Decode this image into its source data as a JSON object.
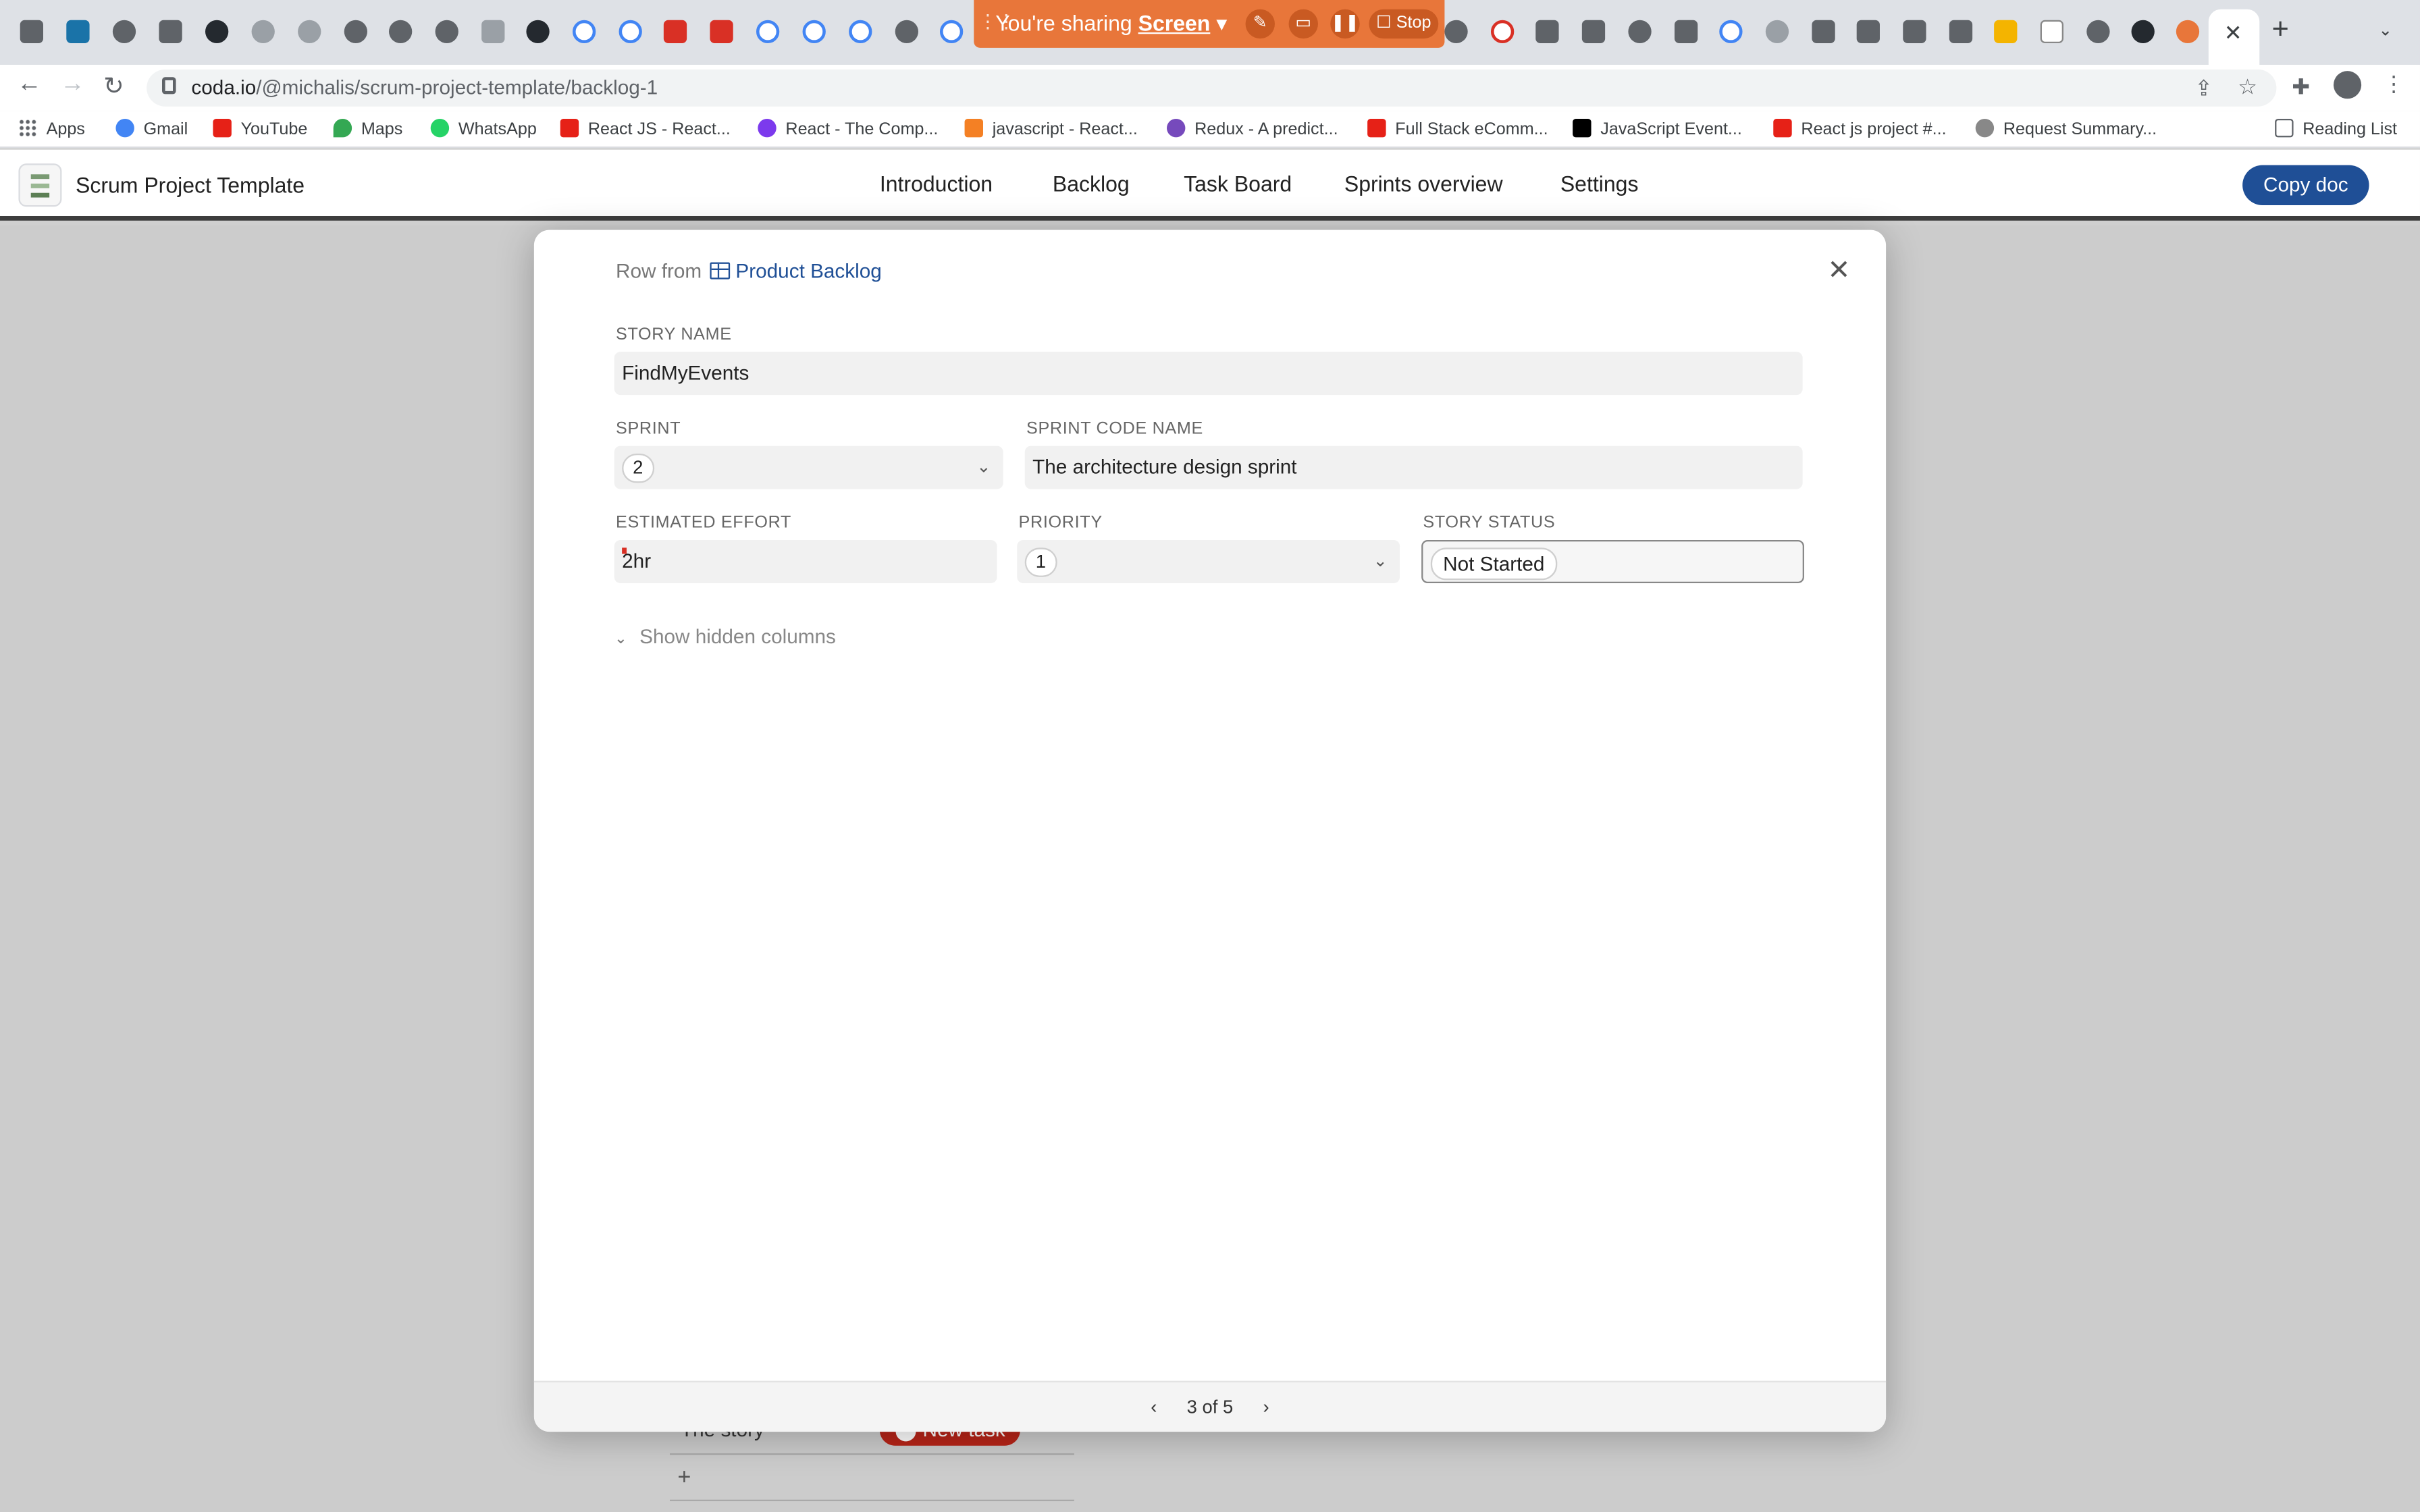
{
  "browser": {
    "sharing_banner": {
      "prefix": "You're sharing",
      "target": "Screen",
      "stop_label": "Stop"
    },
    "url_host": "coda.io",
    "url_path": "/@michalis/scrum-project-template/backlog-1",
    "reading_list_label": "Reading List",
    "bookmarks": [
      {
        "label": "Apps",
        "icon": "apps-grid-icon"
      },
      {
        "label": "Gmail",
        "icon": "google-icon",
        "color": "#4285f4"
      },
      {
        "label": "YouTube",
        "icon": "youtube-icon",
        "color": "#e62117"
      },
      {
        "label": "Maps",
        "icon": "maps-icon",
        "color": "#34a853"
      },
      {
        "label": "WhatsApp",
        "icon": "whatsapp-icon",
        "color": "#25d366"
      },
      {
        "label": "React JS - React...",
        "icon": "youtube-icon",
        "color": "#e62117"
      },
      {
        "label": "React - The Comp...",
        "icon": "react-icon",
        "color": "#7c3aed"
      },
      {
        "label": "javascript - React...",
        "icon": "stackoverflow-icon",
        "color": "#f48024"
      },
      {
        "label": "Redux - A predict...",
        "icon": "redux-icon",
        "color": "#764abc"
      },
      {
        "label": "Full Stack eComm...",
        "icon": "youtube-icon",
        "color": "#e62117"
      },
      {
        "label": "JavaScript Event...",
        "icon": "medium-icon",
        "color": "#000000"
      },
      {
        "label": "React js project #...",
        "icon": "youtube-icon",
        "color": "#e62117"
      },
      {
        "label": "Request Summary...",
        "icon": "chatgpt-icon",
        "color": "#888888"
      }
    ]
  },
  "app": {
    "doc_title": "Scrum Project Template",
    "nav": [
      "Introduction",
      "Backlog",
      "Task Board",
      "Sprints overview",
      "Settings"
    ],
    "copy_doc_label": "Copy doc",
    "accent": "#1f4f96"
  },
  "background": {
    "row_label": "The story",
    "new_task_label": "New task",
    "add_label": "+"
  },
  "modal": {
    "row_from_prefix": "Row from",
    "table_name": "Product Backlog",
    "fields": {
      "story_name": {
        "label": "STORY NAME",
        "value": "FindMyEvents"
      },
      "sprint": {
        "label": "SPRINT",
        "value": "2"
      },
      "sprint_code_name": {
        "label": "SPRINT CODE NAME",
        "value": "The architecture design sprint"
      },
      "estimated_effort": {
        "label": "ESTIMATED EFFORT",
        "value": "2hr"
      },
      "priority": {
        "label": "PRIORITY",
        "value": "1"
      },
      "story_status": {
        "label": "STORY STATUS",
        "value": "Not Started"
      }
    },
    "show_hidden_label": "Show hidden columns",
    "pager": {
      "text": "3 of 5"
    }
  }
}
